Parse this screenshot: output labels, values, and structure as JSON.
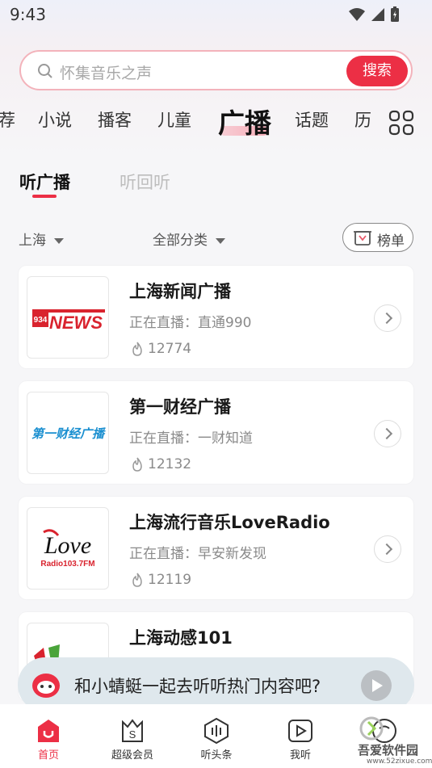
{
  "status_bar": {
    "time": "9:43"
  },
  "search": {
    "placeholder": "怀集音乐之声",
    "button": "搜索"
  },
  "categories": [
    "荐",
    "小说",
    "播客",
    "儿童",
    "广播",
    "话题",
    "历"
  ],
  "sub_tabs": [
    "听广播",
    "听回听"
  ],
  "filters": {
    "region": "上海",
    "category": "全部分类",
    "ranking": "榜单"
  },
  "stations": [
    {
      "name": "上海新闻广播",
      "live": "正在直播：直通990",
      "count": "12774",
      "logo_text": "NEWS",
      "logo_num": "934"
    },
    {
      "name": "第一财经广播",
      "live": "正在直播：一财知道",
      "count": "12132",
      "logo_text": "第一财经广播"
    },
    {
      "name": "上海流行音乐LoveRadio",
      "live": "正在直播：早安新发现",
      "count": "12119",
      "logo_text": "Love",
      "logo_sub": "Radio103.7FM"
    },
    {
      "name": "上海动感101",
      "live": "",
      "count": ""
    }
  ],
  "banner": {
    "text": "和小蜻蜓一起去听听热门内容吧?"
  },
  "bottom_nav": [
    "首页",
    "超级会员",
    "听头条",
    "我听",
    ""
  ],
  "watermark": {
    "text": "吾爱软件园",
    "url": "www.52zixue.com"
  },
  "colors": {
    "accent": "#ec2f45",
    "banner_bg": "#dfe8ed"
  }
}
